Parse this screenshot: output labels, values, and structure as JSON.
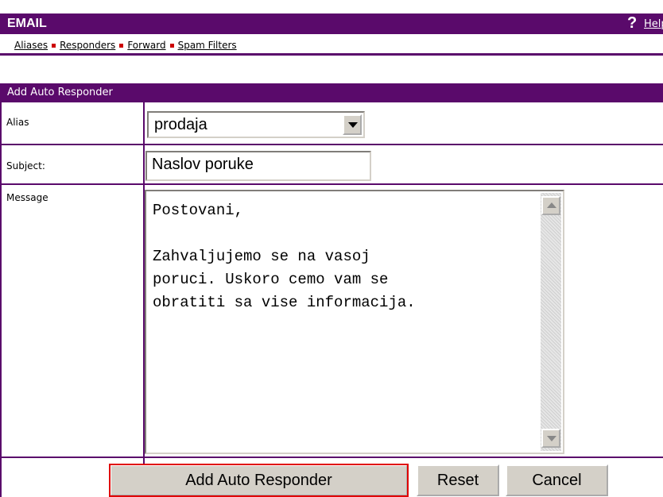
{
  "header": {
    "title": "EMAIL",
    "help_icon": "?",
    "help_label": "Help"
  },
  "subnav": {
    "items": [
      "Aliases",
      "Responders",
      "Forward",
      "Spam Filters"
    ]
  },
  "form": {
    "panel_title": "Add Auto Responder",
    "alias_label": "Alias",
    "alias_value": "prodaja",
    "subject_label": "Subject:",
    "subject_value": "Naslov poruke",
    "message_label": "Message",
    "message_value": "Postovani,\n\nZahvaljujemo se na vasoj\nporuci. Uskoro cemo vam se\nobratiti sa vise informacija."
  },
  "buttons": {
    "add_label": "Add Auto Responder",
    "reset_label": "Reset",
    "cancel_label": "Cancel"
  },
  "colors": {
    "brand": "#5a0a6b",
    "separator": "#cc0000",
    "focus_outline": "#e00000"
  }
}
